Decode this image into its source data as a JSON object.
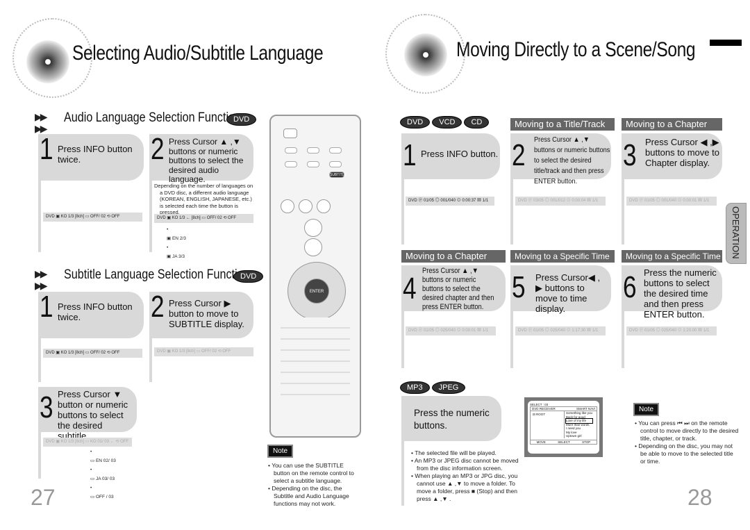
{
  "left_page": {
    "title": "Selecting Audio/Subtitle Language",
    "page_number": "27",
    "audio_section": {
      "title": "Audio Language Selection Function",
      "badge": "DVD",
      "step1": {
        "num": "1",
        "text": "Press INFO button twice.",
        "status": "DVD  ▣ KO 1/3  [8ch]   ▭ OFF/ 02    ⟲ OFF"
      },
      "step2": {
        "num": "2",
        "text": "Press Cursor ▲ ,▼ buttons or numeric buttons to select the desired audio language.",
        "bullet": "Depending on the number of languages on a DVD disc, a different audio language (KOREAN, ENGLISH, JAPANESE, etc.) is selected each time the button is pressed.",
        "status": "DVD  ▣ KO 1/3 ←  [8ch]   ▭ OFF/ 02    ⟲ OFF",
        "chain": [
          "EN 2/3",
          "JA 3/3"
        ]
      }
    },
    "subtitle_section": {
      "title": "Subtitle Language Selection Function",
      "badge": "DVD",
      "step1": {
        "num": "1",
        "text": "Press INFO button twice.",
        "status": "DVD  ▣ KO 1/3  [8ch]   ▭ OFF/ 02    ⟲ OFF"
      },
      "step2": {
        "num": "2",
        "text": "Press Cursor ▶ button to move to SUBTITLE display.",
        "status": "DVD  ▣ KO 1/3  [8ch]   ▭ OFF/ 02    ⟲ OFF"
      },
      "step3": {
        "num": "3",
        "text": "Press Cursor ▼ button or numeric buttons to select the desired subtitle.",
        "status": "DVD  ▣ KO 1/3  [8ch]   ▭ KO 01/ 03 ←  ⟲ OFF",
        "chain": [
          "EN 02/ 03",
          "JA 03/ 03",
          "OFF / 03"
        ]
      }
    },
    "remote": {
      "labels": [
        "SUBTITLE",
        "ENTER"
      ]
    },
    "note": {
      "label": "Note",
      "bullets": [
        "You can use the SUBTITLE button on the remote control to select a subtitle language.",
        "Depending on the disc, the Subtitle and Audio Language functions may not work."
      ]
    }
  },
  "right_page": {
    "title": "Moving Directly to a Scene/Song",
    "page_number": "28",
    "side_tab": "OPERATION",
    "disc_badges": [
      "DVD",
      "VCD",
      "CD"
    ],
    "headers": [
      "Moving to a Title/Track",
      "Moving to a Chapter",
      "Moving to a Chapter",
      "Moving to a Specific Time",
      "Moving to a Specific Time"
    ],
    "steps": [
      {
        "num": "1",
        "text": "Press INFO button.",
        "status": "DVD  ⓟ 01/05  ◎ 001/040  ⊙ 0:00:37  ▦ 1/1"
      },
      {
        "num": "2",
        "text": "Press Cursor ▲ ,▼ buttons or numeric buttons to select the desired title/track and then press ENTER button.",
        "status": "DVD  ⓟ 03/05  ◎ 001/012  ⊙ 0:00:04  ▦ 1/1"
      },
      {
        "num": "3",
        "text": "Press Cursor ◀ ,▶ buttons to move to Chapter display.",
        "status": "DVD  ⓟ 01/05  ◎ 001/040  ⊙ 0:00:01  ▦ 1/1"
      },
      {
        "num": "4",
        "text": "Press Cursor ▲ ,▼ buttons or numeric buttons to select the desired chapter and then press ENTER button.",
        "status": "DVD  ⓟ 01/05  ◎ 025/040  ⊙ 0:00:01  ▦ 1/1"
      },
      {
        "num": "5",
        "text": "Press Cursor◀ , ▶ buttons to move to time display.",
        "status": "DVD  ⓟ 01/05  ◎ 025/040  ⊙ 1:17:30  ▦ 1/1"
      },
      {
        "num": "6",
        "text": "Press the numeric buttons to select the desired time and then press ENTER button.",
        "status": "DVD  ⓟ 01/05  ◎ 025/040  ⊙ 1:20:00  ▦ 1/1"
      }
    ],
    "mp3_badges": [
      "MP3",
      "JPEG"
    ],
    "mp3_step": {
      "text": "Press the numeric buttons.",
      "bullets": [
        "The selected file will be played.",
        "An MP3 or JPEG disc cannot be moved from the disc information screen.",
        "When playing an MP3 or JPG disc, you cannot use ▲ ,▼  to move a folder. To move a folder, press ■ (Stop) and then press ▲ ,▼ ."
      ]
    },
    "screen": {
      "select": "SELECT :  03",
      "left_header": "DVD RECEIVER",
      "right_header": "SMART NAVI",
      "folder": "ROOT",
      "tracks": [
        "Something like you",
        "Back for good",
        "Love of my life",
        "More than words",
        "I need you",
        "My love",
        "Uptown girl"
      ],
      "selected_track": 2,
      "footer": [
        "MOVE",
        "SELECT",
        "STOP"
      ]
    },
    "note": {
      "label": "Note",
      "bullets": [
        "You can press ⏮ ⏭  on the remote control to move directly to the desired title, chapter, or track.",
        "Depending on the disc, you may not be able to move to the selected title or time."
      ]
    }
  }
}
